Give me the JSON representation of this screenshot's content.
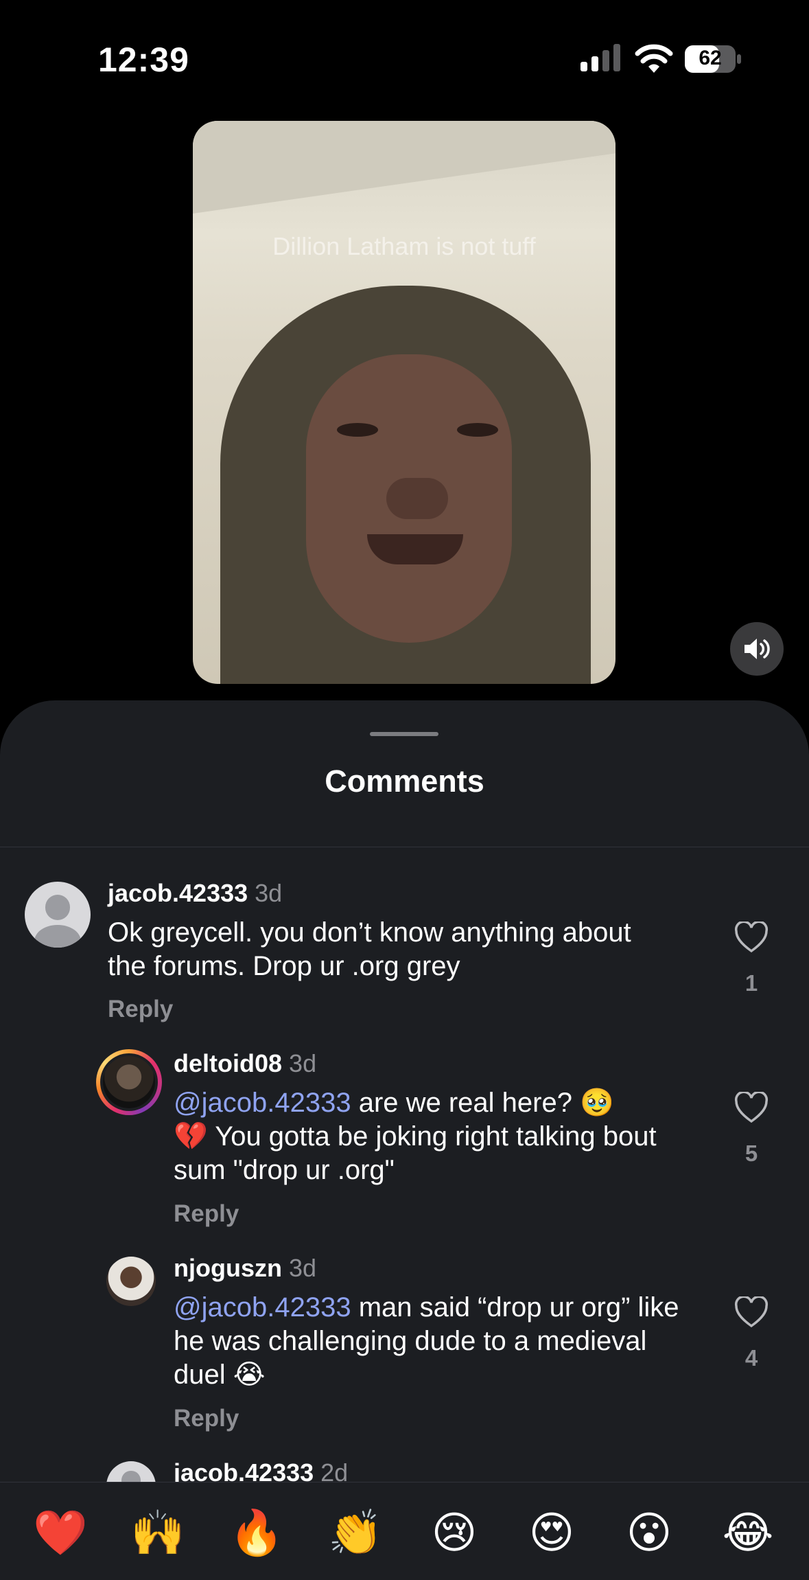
{
  "status_bar": {
    "time": "12:39",
    "battery": "62"
  },
  "video": {
    "caption": "Dillion Latham is not tuff"
  },
  "sheet": {
    "title": "Comments"
  },
  "comments": [
    {
      "username": "jacob.42333",
      "time": "3d",
      "text": "Ok greycell. you don’t know anything about the forums. Drop ur .org grey",
      "reply": "Reply",
      "likes": "1"
    },
    {
      "username": "deltoid08",
      "time": "3d",
      "mention": "@jacob.42333",
      "text_line1": " are we real here? 🥹",
      "text_rest": "💔 You gotta be joking right talking bout sum \"drop ur .org\"",
      "reply": "Reply",
      "likes": "5"
    },
    {
      "username": "njoguszn",
      "time": "3d",
      "mention": "@jacob.42333",
      "text": " man said “drop ur org” like he was challenging dude to a medieval duel 😭",
      "reply": "Reply",
      "likes": "4"
    },
    {
      "username": "jacob.42333",
      "time": "2d"
    }
  ],
  "emoji_bar": [
    "❤️",
    "🙌",
    "🔥",
    "👏",
    "😢",
    "😍",
    "😮",
    "😂"
  ],
  "icons": {
    "signal": "signal-icon",
    "wifi": "wifi-icon",
    "battery": "battery-icon",
    "sound": "speaker-icon",
    "heart": "heart-outline-icon"
  },
  "colors": {
    "background": "#000000",
    "sheet": "#1c1e22",
    "mention": "#8fa3f1",
    "muted": "#8e8f94"
  }
}
